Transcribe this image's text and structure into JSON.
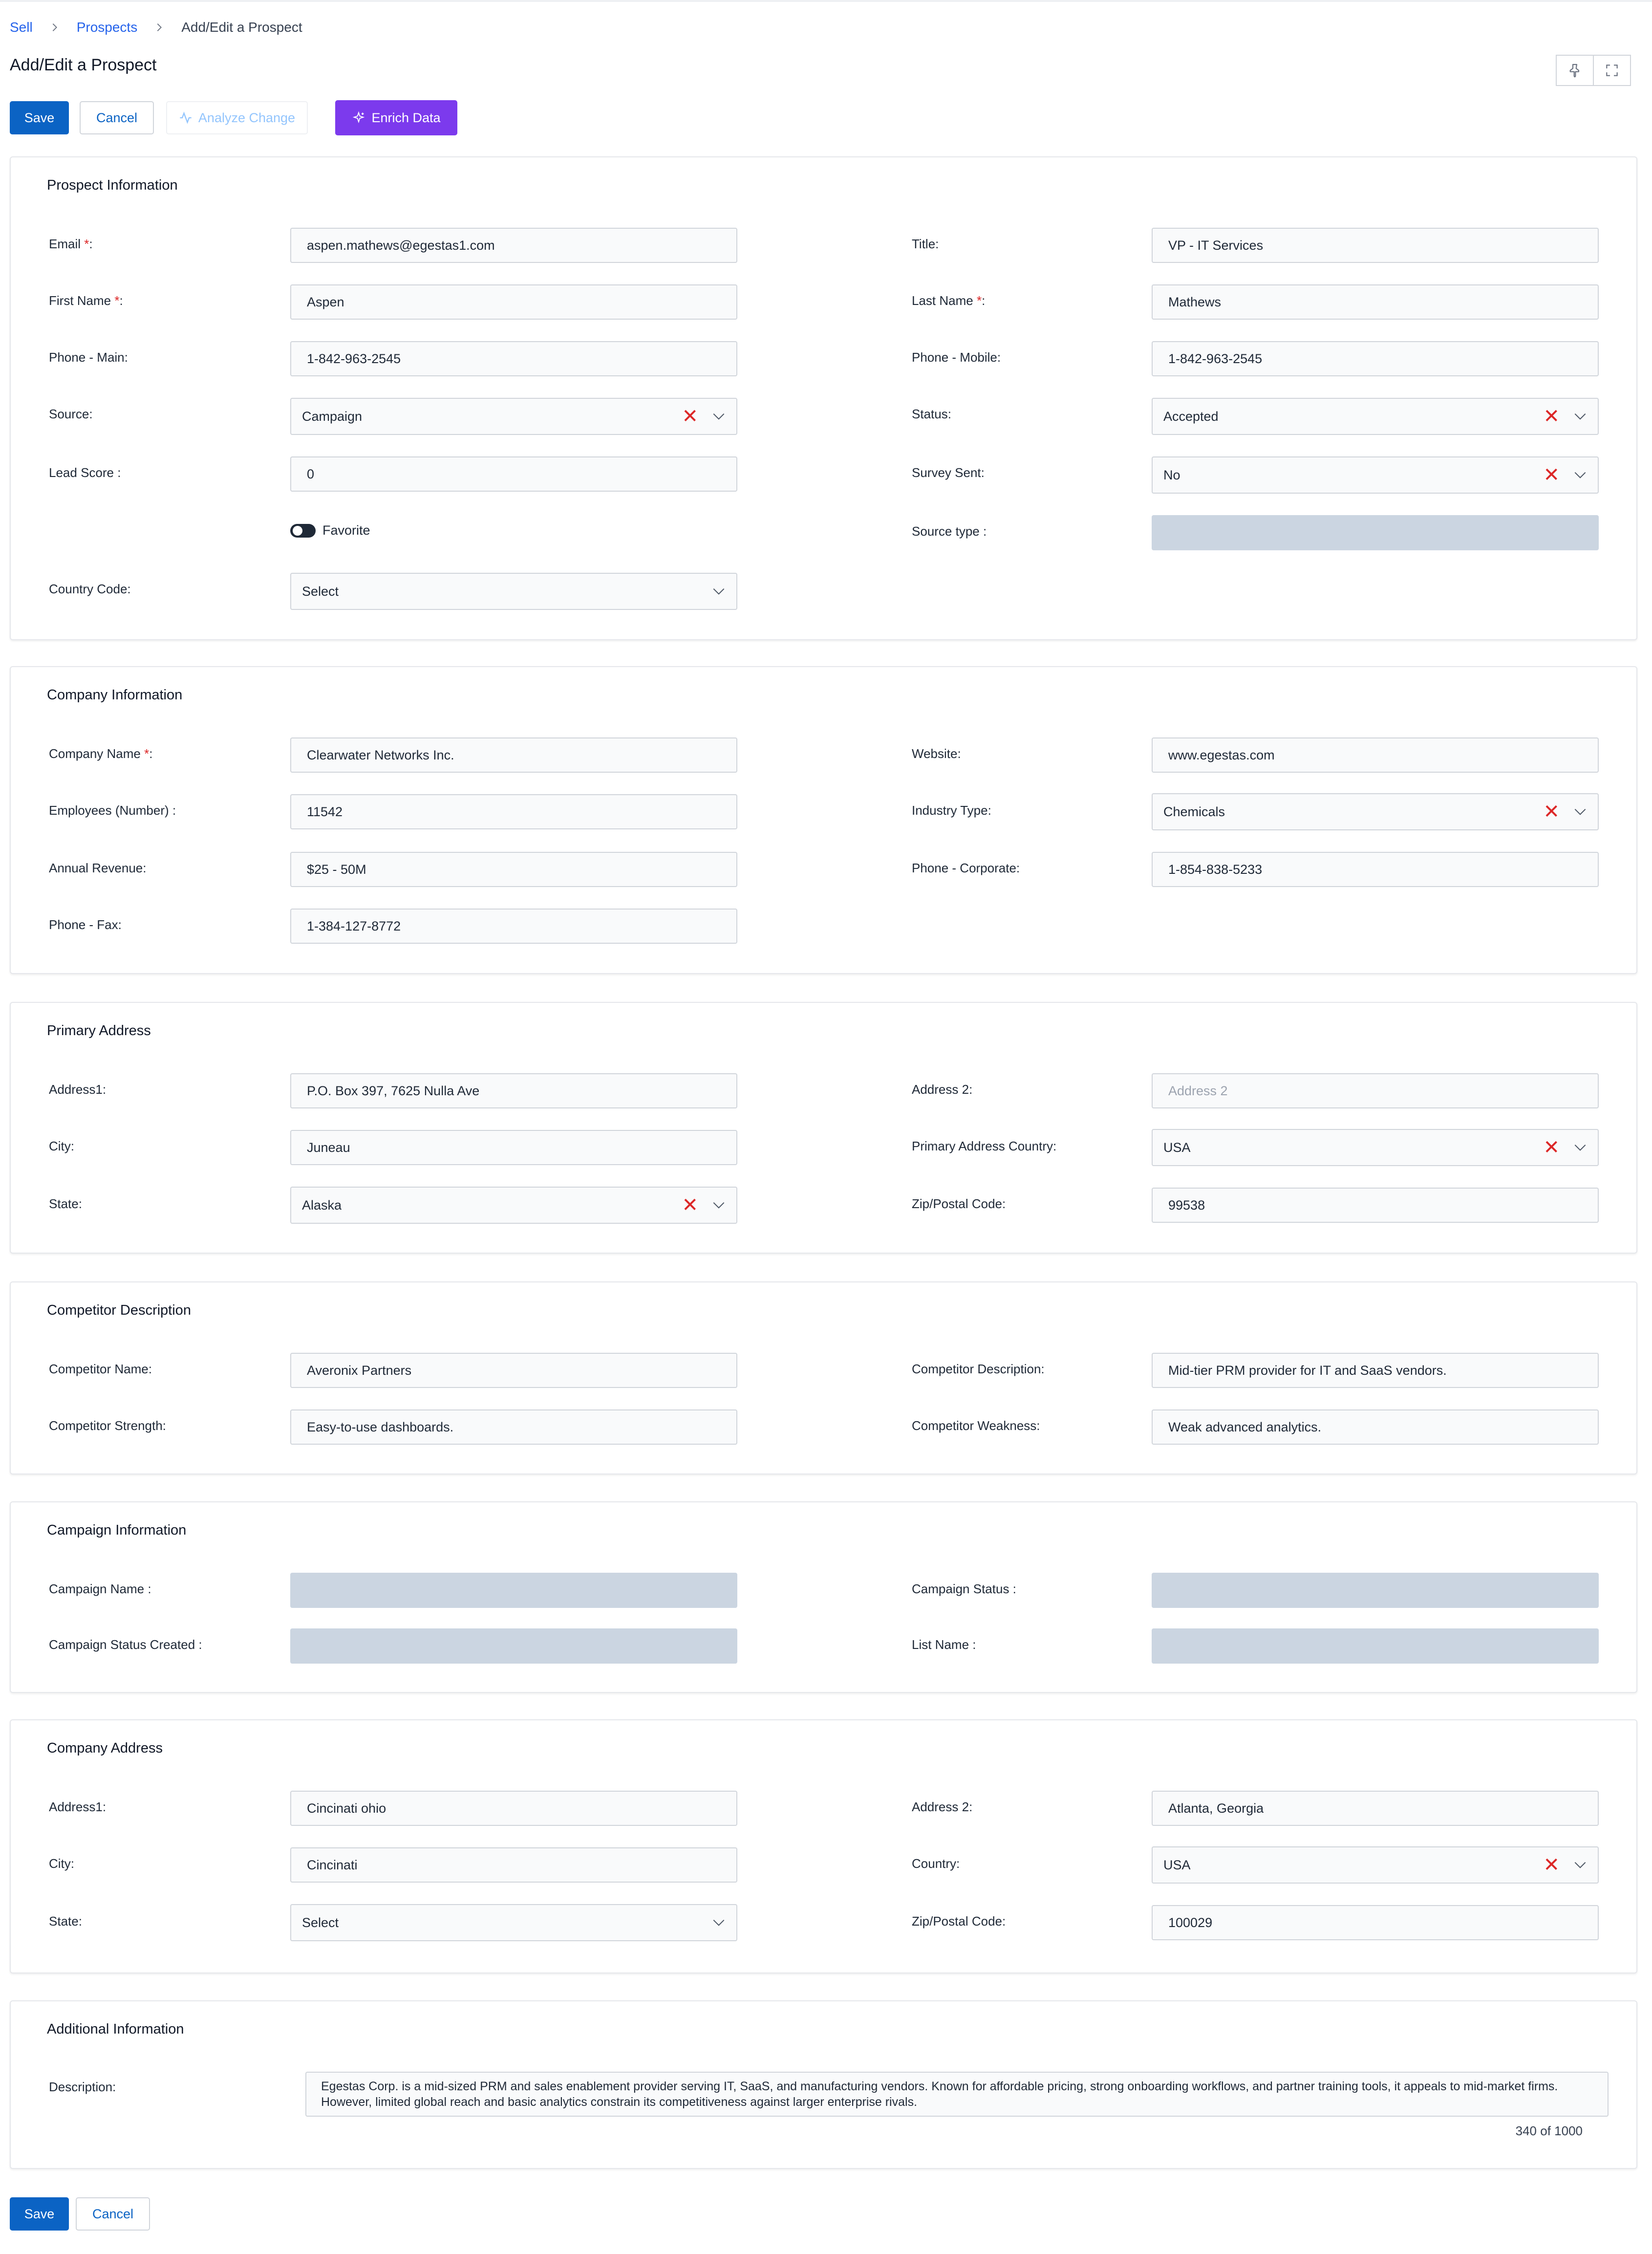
{
  "breadcrumb": [
    "Sell",
    "Prospects",
    "Add/Edit a Prospect"
  ],
  "page_title": "Add/Edit a Prospect",
  "toolbar": {
    "save": "Save",
    "cancel": "Cancel",
    "analyze": "Analyze Change",
    "enrich": "Enrich Data",
    "icons": [
      "pin-icon",
      "expand-icon"
    ]
  },
  "sections": {
    "prospect": {
      "title": "Prospect Information",
      "email": {
        "label": "Email",
        "value": "aspen.mathews@egestas1.com"
      },
      "title_field": {
        "label": "Title:",
        "value": "VP - IT Services"
      },
      "first_name": {
        "label": "First Name",
        "value": "Aspen"
      },
      "last_name": {
        "label": "Last Name",
        "value": "Mathews"
      },
      "phone_main": {
        "label": "Phone - Main:",
        "value": "1-842-963-2545"
      },
      "phone_mobile": {
        "label": "Phone - Mobile:",
        "value": "1-842-963-2545"
      },
      "source": {
        "label": "Source:",
        "value": "Campaign"
      },
      "status": {
        "label": "Status:",
        "value": "Accepted"
      },
      "lead_score": {
        "label": "Lead Score :",
        "value": "0"
      },
      "survey_sent": {
        "label": "Survey Sent:",
        "value": "No"
      },
      "favorite": {
        "label": "Favorite"
      },
      "source_type": {
        "label": "Source type :",
        "value": ""
      },
      "country_code": {
        "label": "Country Code:",
        "value": "Select"
      }
    },
    "company": {
      "title": "Company Information",
      "company_name": {
        "label": "Company Name",
        "value": "Clearwater Networks Inc."
      },
      "website": {
        "label": "Website:",
        "value": "www.egestas.com"
      },
      "employees": {
        "label": "Employees (Number) :",
        "value": "11542"
      },
      "industry": {
        "label": "Industry Type:",
        "value": "Chemicals"
      },
      "revenue": {
        "label": "Annual Revenue:",
        "value": "$25 - 50M"
      },
      "phone_corp": {
        "label": "Phone - Corporate:",
        "value": "1-854-838-5233"
      },
      "phone_fax": {
        "label": "Phone - Fax:",
        "value": "1-384-127-8772"
      }
    },
    "primary_address": {
      "title": "Primary Address",
      "address1": {
        "label": "Address1:",
        "value": "P.O. Box 397, 7625 Nulla Ave"
      },
      "address2": {
        "label": "Address 2:",
        "placeholder": "Address 2"
      },
      "city": {
        "label": "City:",
        "value": "Juneau"
      },
      "country": {
        "label": "Primary Address Country:",
        "value": "USA"
      },
      "state": {
        "label": "State:",
        "value": "Alaska"
      },
      "zip": {
        "label": "Zip/Postal Code:",
        "value": "99538"
      }
    },
    "competitor": {
      "title": "Competitor Description",
      "name": {
        "label": "Competitor Name:",
        "value": "Averonix Partners"
      },
      "description": {
        "label": "Competitor Description:",
        "value": "Mid-tier PRM provider for IT and SaaS vendors."
      },
      "strength": {
        "label": "Competitor Strength:",
        "value": "Easy-to-use dashboards."
      },
      "weakness": {
        "label": "Competitor Weakness:",
        "value": "Weak advanced analytics."
      }
    },
    "campaign": {
      "title": "Campaign Information",
      "name": {
        "label": "Campaign Name :"
      },
      "status": {
        "label": "Campaign Status :"
      },
      "status_created": {
        "label": "Campaign Status Created :"
      },
      "list_name": {
        "label": "List Name :"
      }
    },
    "company_address": {
      "title": "Company Address",
      "address1": {
        "label": "Address1:",
        "value": "Cincinati ohio"
      },
      "address2": {
        "label": "Address 2:",
        "value": "Atlanta, Georgia"
      },
      "city": {
        "label": "City:",
        "value": "Cincinati"
      },
      "country": {
        "label": "Country:",
        "value": "USA"
      },
      "state": {
        "label": "State:",
        "value": "Select"
      },
      "zip": {
        "label": "Zip/Postal Code:",
        "value": "100029"
      }
    },
    "additional": {
      "title": "Additional Information",
      "description": {
        "label": "Description:",
        "value": "Egestas Corp. is a mid-sized PRM and sales enablement provider serving IT, SaaS, and manufacturing vendors. Known for affordable pricing, strong onboarding workflows, and partner training tools, it appeals to mid-market firms. However, limited global reach and basic analytics constrain its competitiveness against larger enterprise rivals.",
        "counter": "340 of 1000"
      }
    }
  },
  "footer": {
    "save": "Save",
    "cancel": "Cancel"
  },
  "colors": {
    "primary": "#0b63c4",
    "enrich": "#7c3aed",
    "clear": "#dc2626",
    "disabled_field": "#cbd5e1"
  }
}
